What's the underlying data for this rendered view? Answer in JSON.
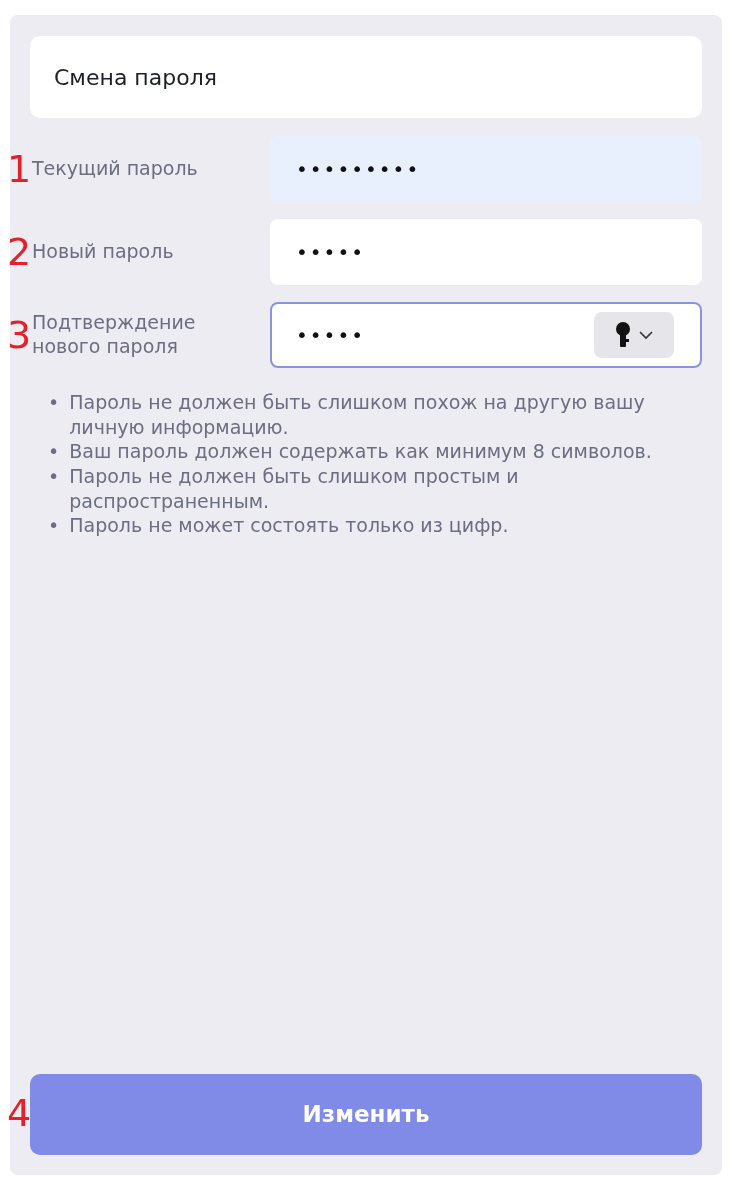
{
  "title": "Смена пароля",
  "fields": [
    {
      "marker": "1",
      "label": "Текущий пароль",
      "value": "•••••••••",
      "autofilled": true,
      "focused": false,
      "key_button": false
    },
    {
      "marker": "2",
      "label": "Новый пароль",
      "value": "•••••",
      "autofilled": false,
      "focused": false,
      "key_button": false
    },
    {
      "marker": "3",
      "label": "Подтверждение нового пароля",
      "value": "•••••",
      "autofilled": false,
      "focused": true,
      "key_button": true
    }
  ],
  "hints": [
    {
      "bullet": "•",
      "text": "Пароль не должен быть слишком похож на другую вашу личную информацию."
    },
    {
      "bullet": "•",
      "text": "Ваш пароль должен содержать как минимум 8 символов."
    },
    {
      "bullet": "•",
      "text": "Пароль не должен быть слишком простым и распространенным."
    },
    {
      "bullet": "•",
      "text": "Пароль не может состоять только из цифр."
    }
  ],
  "submit_button": {
    "marker": "4",
    "label": "Изменить"
  }
}
